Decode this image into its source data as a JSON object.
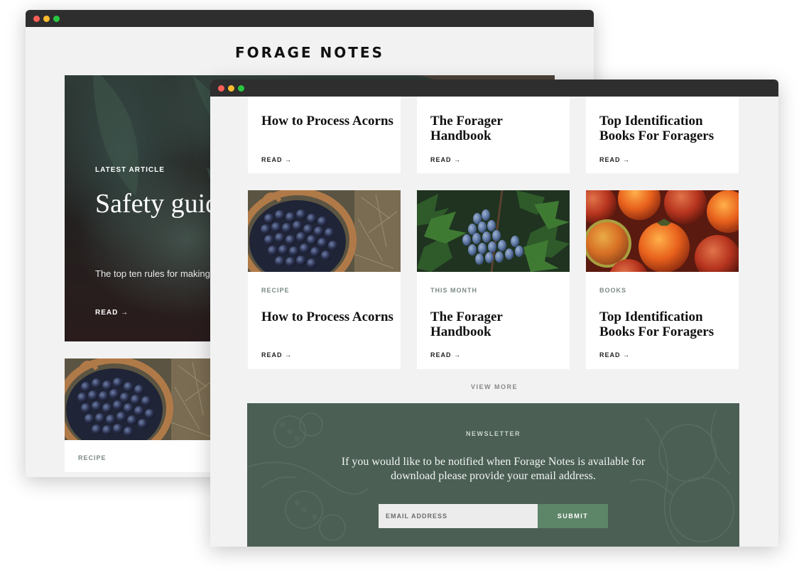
{
  "back_window": {
    "site_title": "FORAGE NOTES",
    "hero": {
      "kicker": "LATEST ARTICLE",
      "headline": "Safety guidelines for eating wild",
      "subtitle": "The top ten rules for making your foraging for your next harvest",
      "read_label": "READ →"
    },
    "card": {
      "category": "RECIPE"
    }
  },
  "front_window": {
    "top_row": [
      {
        "title": "How to Process Acorns",
        "read_label": "READ →"
      },
      {
        "title": "The Forager Handbook",
        "read_label": "READ →"
      },
      {
        "title": "Top Identification Books For Foragers",
        "read_label": "READ →"
      }
    ],
    "cards": [
      {
        "category": "RECIPE",
        "title": "How to Process Acorns",
        "read_label": "READ →",
        "image": "basket-of-blueberries"
      },
      {
        "category": "THIS MONTH",
        "title": "The Forager Handbook",
        "read_label": "READ →",
        "image": "oregon-grape-berries"
      },
      {
        "category": "BOOKS",
        "title": "Top Identification Books For Foragers",
        "read_label": "READ →",
        "image": "persimmons"
      }
    ],
    "view_more_label": "VIEW MORE",
    "newsletter": {
      "kicker": "NEWSLETTER",
      "text": "If you would like to be notified when Forage Notes is available for download please provide your email address.",
      "email_placeholder": "EMAIL ADDRESS",
      "submit_label": "SUBMIT"
    }
  },
  "colors": {
    "window_chrome": "#2e2e2e",
    "page_background": "#f2f2f2",
    "newsletter_background": "#4b5f55",
    "submit_button": "#5d8568",
    "category_text": "#7a8a85"
  }
}
